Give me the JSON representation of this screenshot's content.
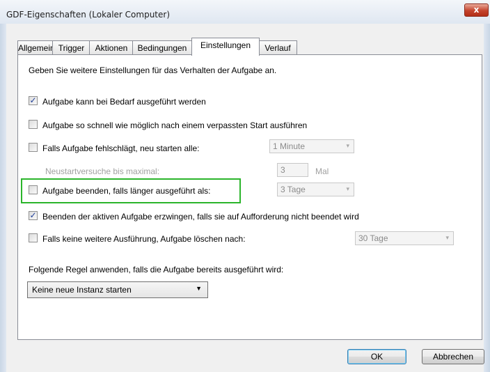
{
  "window": {
    "title": "GDF-Eigenschaften (Lokaler Computer)",
    "close_label": "x"
  },
  "tabs": [
    {
      "label": "Allgemein",
      "active": false
    },
    {
      "label": "Trigger",
      "active": false
    },
    {
      "label": "Aktionen",
      "active": false
    },
    {
      "label": "Bedingungen",
      "active": false
    },
    {
      "label": "Einstellungen",
      "active": true
    },
    {
      "label": "Verlauf",
      "active": false
    }
  ],
  "settings": {
    "intro": "Geben Sie weitere Einstellungen für das Verhalten der Aufgabe an.",
    "on_demand": {
      "label": "Aufgabe kann bei Bedarf ausgeführt werden",
      "checked": true,
      "mark": "✓"
    },
    "missed_start": {
      "label": "Aufgabe so schnell wie möglich nach einem verpassten Start ausführen",
      "checked": false
    },
    "restart_on_fail": {
      "label": "Falls Aufgabe fehlschlägt, neu starten alle:",
      "checked": false,
      "interval": "1 Minute"
    },
    "restart_attempts": {
      "label": "Neustartversuche bis maximal:",
      "value": "3",
      "unit": "Mal"
    },
    "stop_if_longer": {
      "label": "Aufgabe beenden, falls länger ausgeführt als:",
      "checked": false,
      "duration": "3 Tage"
    },
    "force_stop": {
      "label": "Beenden der aktiven Aufgabe erzwingen, falls sie auf Aufforderung nicht beendet wird",
      "checked": true,
      "mark": "✓"
    },
    "delete_after": {
      "label": "Falls keine weitere Ausführung, Aufgabe löschen nach:",
      "checked": false,
      "duration": "30 Tage"
    },
    "rule_label": "Folgende Regel anwenden, falls die Aufgabe bereits ausgeführt wird:",
    "rule_value": "Keine neue Instanz starten"
  },
  "icons": {
    "dropdown": "▼",
    "dropdown_small": "▾"
  },
  "buttons": {
    "ok": "OK",
    "cancel": "Abbrechen"
  },
  "colors": {
    "highlight": "#2bb52b",
    "close_button": "#c4432c"
  }
}
